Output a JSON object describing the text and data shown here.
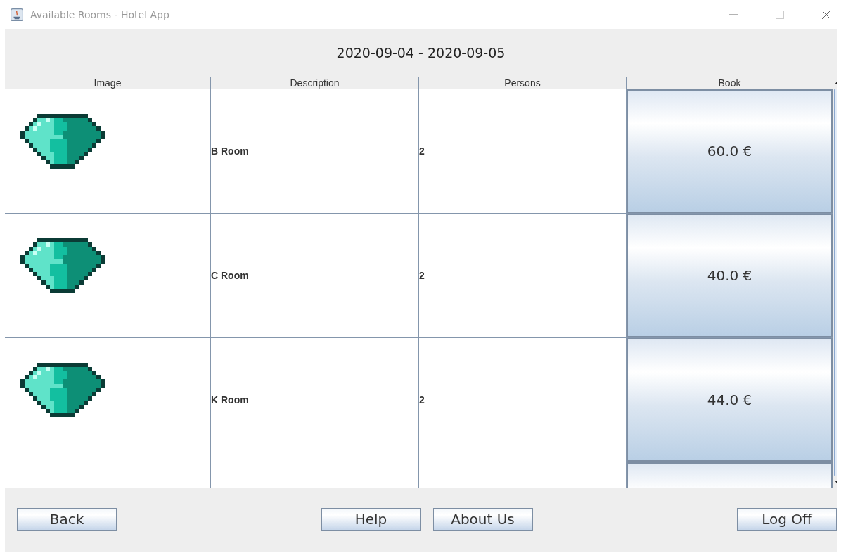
{
  "window": {
    "title": "Available Rooms - Hotel App"
  },
  "date_range": "2020-09-04 - 2020-09-05",
  "table": {
    "columns": [
      "Image",
      "Description",
      "Persons",
      "Book"
    ],
    "rows": [
      {
        "description": "B Room",
        "persons": "2",
        "price": "60.0 €"
      },
      {
        "description": "C Room",
        "persons": "2",
        "price": "40.0 €"
      },
      {
        "description": "K Room",
        "persons": "2",
        "price": "44.0 €"
      }
    ]
  },
  "buttons": {
    "left": [
      "Back"
    ],
    "center": [
      "Help",
      "About Us"
    ],
    "right": [
      "Log Off"
    ]
  }
}
